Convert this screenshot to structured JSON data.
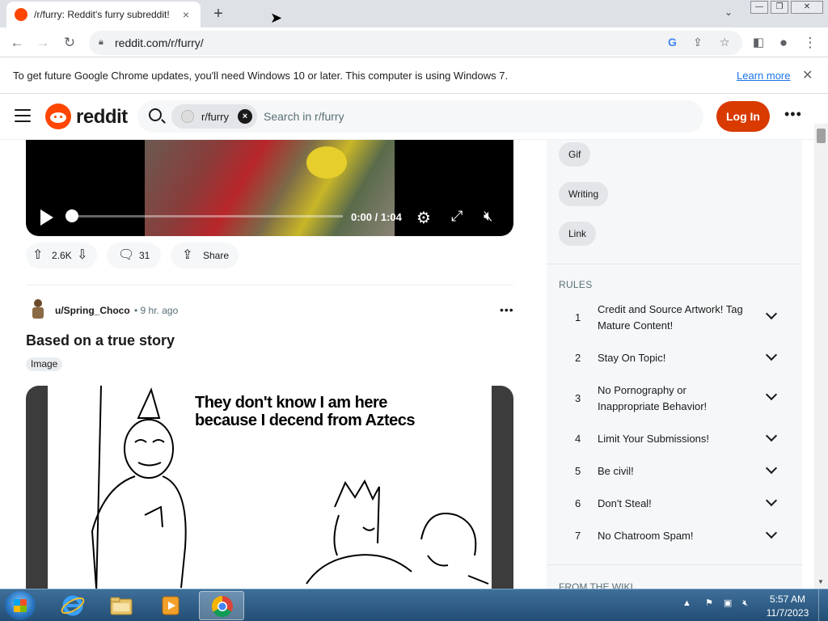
{
  "browser": {
    "tab_title": "/r/furry: Reddit's furry subreddit!",
    "tab_close": "×",
    "new_tab": "+",
    "tabs_dropdown": "⌄",
    "window_min": "—",
    "window_restore": "❐",
    "window_close": "✕",
    "url": "reddit.com/r/furry/"
  },
  "infobar": {
    "message": "To get future Google Chrome updates, you'll need Windows 10 or later. This computer is using Windows 7.",
    "link": "Learn more",
    "close": "✕"
  },
  "reddit_header": {
    "wordmark": "reddit",
    "search_chip": "r/furry",
    "search_chip_clear": "×",
    "search_placeholder": "Search in r/furry",
    "login": "Log In",
    "more": "•••"
  },
  "video": {
    "time": "0:00 / 1:04"
  },
  "post_actions": {
    "upvotes": "2.6K",
    "comments": "31",
    "share": "Share"
  },
  "post": {
    "author": "u/Spring_Choco",
    "time": "• 9 hr. ago",
    "more": "•••",
    "title": "Based on a true story",
    "flair": "Image",
    "meme_text_line1": "They don't know I am here",
    "meme_text_line2": "because I decend from Aztecs"
  },
  "sidebar": {
    "flairs": [
      "Gif",
      "Writing",
      "Link"
    ],
    "rules_heading": "RULES",
    "rules": [
      {
        "num": "1",
        "line1": "Credit and Source Artwork! Tag",
        "line2": "Mature Content!"
      },
      {
        "num": "2",
        "line1": "Stay On Topic!",
        "line2": ""
      },
      {
        "num": "3",
        "line1": "No Pornography or",
        "line2": "Inappropriate Behavior!"
      },
      {
        "num": "4",
        "line1": "Limit Your Submissions!",
        "line2": ""
      },
      {
        "num": "5",
        "line1": "Be civil!",
        "line2": ""
      },
      {
        "num": "6",
        "line1": "Don't Steal!",
        "line2": ""
      },
      {
        "num": "7",
        "line1": "No Chatroom Spam!",
        "line2": ""
      }
    ],
    "wiki_heading": "FROM THE WIKI"
  },
  "taskbar": {
    "time": "5:57 AM",
    "date": "11/7/2023",
    "tray_expand": "▲"
  },
  "colors": {
    "reddit_orange": "#ff4500",
    "login_button": "#d93a00",
    "chrome_tab_strip": "#dee1e6",
    "taskbar": "#2a5a85"
  }
}
